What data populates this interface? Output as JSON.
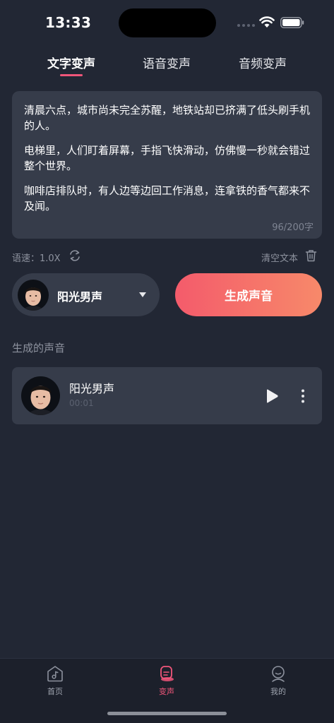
{
  "status": {
    "time": "13:33"
  },
  "tabs": [
    {
      "label": "文字变声",
      "active": true
    },
    {
      "label": "语音变声",
      "active": false
    },
    {
      "label": "音频变声",
      "active": false
    }
  ],
  "editor": {
    "paragraphs": [
      "清晨六点，城市尚未完全苏醒，地铁站却已挤满了低头刷手机的人。",
      "电梯里，人们盯着屏幕，手指飞快滑动，仿佛慢一秒就会错过整个世界。",
      "咖啡店排队时，有人边等边回工作消息，连拿铁的香气都来不及闻。"
    ],
    "char_count": "96/200字"
  },
  "controls": {
    "speed_label": "语速：1.0X",
    "clear_label": "清空文本"
  },
  "voice": {
    "name": "阳光男声"
  },
  "generate_button": "生成声音",
  "generated": {
    "section_title": "生成的声音",
    "items": [
      {
        "name": "阳光男声",
        "duration": "00:01"
      }
    ]
  },
  "nav": {
    "items": [
      {
        "label": "首页",
        "icon": "music-home-icon",
        "active": false
      },
      {
        "label": "变声",
        "icon": "voice-change-icon",
        "active": true
      },
      {
        "label": "我的",
        "icon": "profile-icon",
        "active": false
      }
    ]
  },
  "colors": {
    "accent": "#f0567a",
    "gradient_start": "#f45b6b",
    "gradient_end": "#f7896a",
    "background": "#222734",
    "card": "#363c4a"
  }
}
